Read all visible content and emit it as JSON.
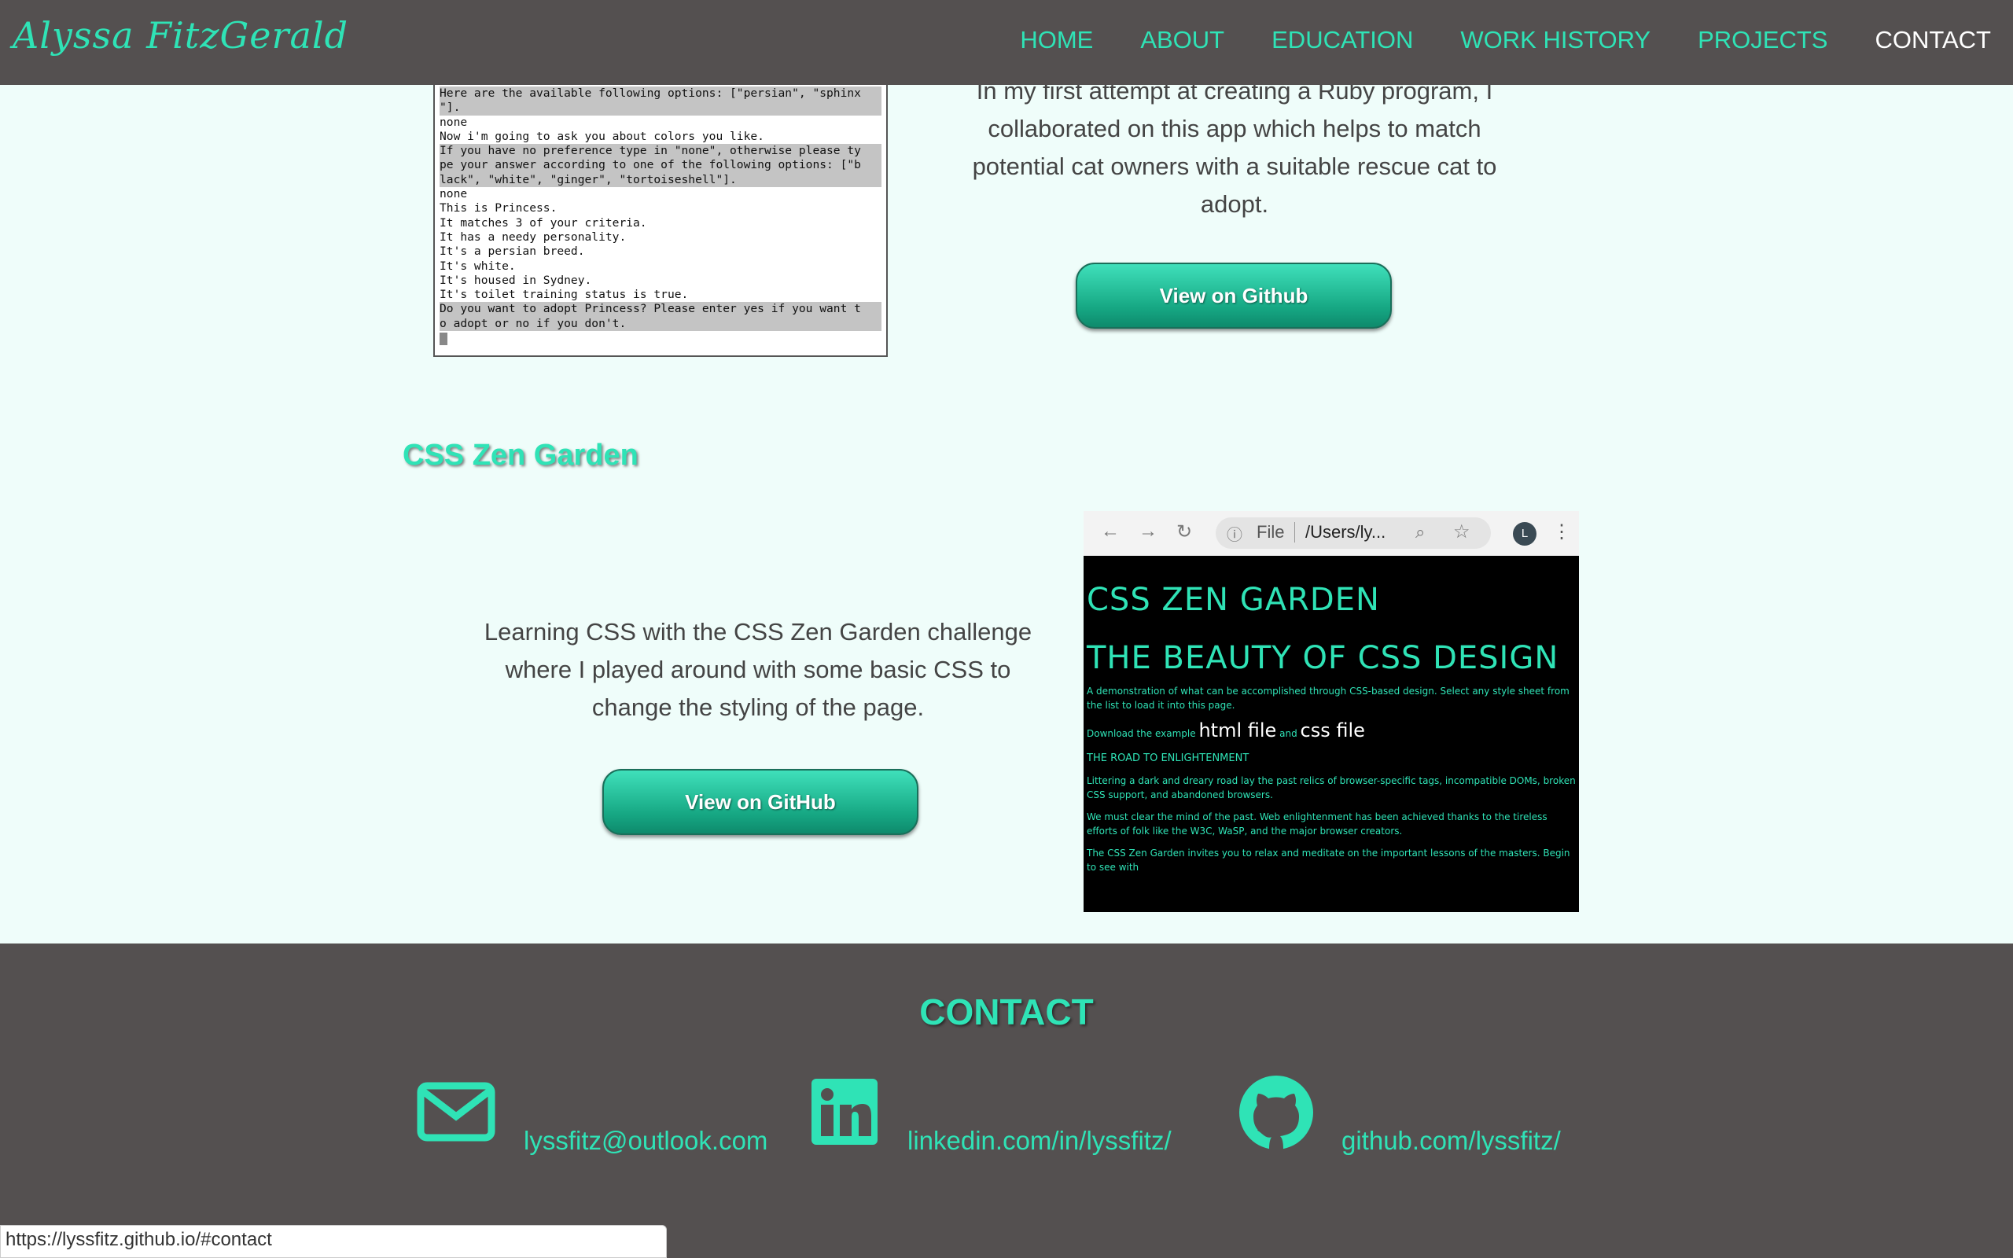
{
  "nav": {
    "brand": "Alyssa FitzGerald",
    "links": [
      "HOME",
      "ABOUT",
      "EDUCATION",
      "WORK HISTORY",
      "PROJECTS",
      "CONTACT"
    ],
    "active": "CONTACT"
  },
  "ruby_project": {
    "terminal_lines": [
      "Here are the available following options: [\"persian\", \"sphinx",
      "\"].",
      "none",
      "Now i'm going to ask you about colors you like.",
      "If you have no preference type in \"none\", otherwise please ty",
      "pe your answer according to one of the following options: [\"b",
      "lack\", \"white\", \"ginger\", \"tortoiseshell\"].",
      "none",
      "This is Princess.",
      "It matches 3 of your criteria.",
      "It has a needy personality.",
      "It's a persian breed.",
      "It's white.",
      "It's housed in Sydney.",
      "It's toilet training status is true.",
      "Do you want to adopt Princess? Please enter yes if you want t",
      "o adopt or no if you don't."
    ],
    "description": "In my first attempt at creating a Ruby program, I collaborated on this app which helps to match potential cat owners with a suitable rescue cat to adopt.",
    "button_label": "View on Github"
  },
  "zen_project": {
    "title": "CSS Zen Garden",
    "description": "Learning CSS with the CSS Zen Garden challenge where I played around with some basic CSS to change the styling of the page.",
    "button_label": "View on GitHub",
    "browser": {
      "url_prefix": "File",
      "url_path": "/Users/ly...",
      "avatar": "L",
      "heading1": "CSS ZEN GARDEN",
      "heading2": "THE BEAUTY OF CSS DESIGN",
      "intro": "A demonstration of what can be accomplished through CSS-based design. Select any style sheet from the list to load it into this page.",
      "download_prefix": "Download the example",
      "html_file": "html file",
      "and": "and",
      "css_file": "css file",
      "road_title": "THE ROAD TO ENLIGHTENMENT",
      "para1": "Littering a dark and dreary road lay the past relics of browser-specific tags, incompatible DOMs, broken CSS support, and abandoned browsers.",
      "para2": "We must clear the mind of the past. Web enlightenment has been achieved thanks to the tireless efforts of folk like the W3C, WaSP, and the major browser creators.",
      "para3": "The CSS Zen Garden invites you to relax and meditate on the important lessons of the masters. Begin to see with"
    }
  },
  "contact": {
    "title": "CONTACT",
    "email": "lyssfitz@outlook.com",
    "linkedin": "linkedin.com/in/lyssfitz/",
    "github": "github.com/lyssfitz/"
  },
  "status_bar": "https://lyssfitz.github.io/#contact",
  "colors": {
    "accent": "#2fe3b6",
    "dark": "#545050",
    "background": "#effdfa"
  }
}
